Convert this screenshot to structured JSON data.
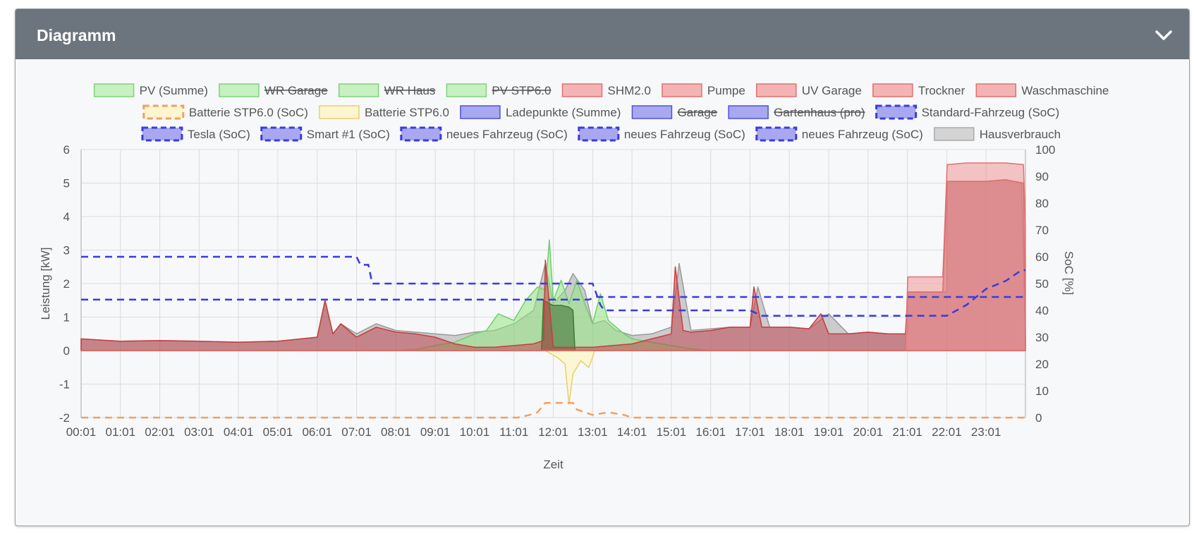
{
  "panel": {
    "title": "Diagramm"
  },
  "chart_data": {
    "type": "area",
    "xlabel": "Zeit",
    "ylabel_left": "Leistung [kW]",
    "ylabel_right": "SoC [%]",
    "ylim_left": [
      -2,
      6
    ],
    "ylim_right": [
      0,
      100
    ],
    "yticks_left": [
      "6",
      "5",
      "4",
      "3",
      "2",
      "1",
      "0",
      "-1",
      "-2"
    ],
    "yticks_right": [
      "100",
      "90",
      "80",
      "70",
      "60",
      "50",
      "40",
      "30",
      "20",
      "10",
      "0"
    ],
    "xticks": [
      "00:01",
      "01:01",
      "02:01",
      "03:01",
      "04:01",
      "05:01",
      "06:01",
      "07:01",
      "08:01",
      "09:01",
      "10:01",
      "11:01",
      "12:01",
      "13:01",
      "14:01",
      "15:01",
      "16:01",
      "17:01",
      "18:01",
      "19:01",
      "20:01",
      "21:01",
      "22:01",
      "23:01"
    ],
    "grid": true,
    "legend_position": "top",
    "legend": [
      {
        "label": "PV (Summe)",
        "color": "#7ed37e",
        "fill": "#c8f0c0",
        "style": "solid",
        "hidden": false
      },
      {
        "label": "WR Garage",
        "color": "#7ed37e",
        "fill": "#c8f0c0",
        "style": "solid",
        "hidden": true
      },
      {
        "label": "WR Haus",
        "color": "#7ed37e",
        "fill": "#c8f0c0",
        "style": "solid",
        "hidden": true
      },
      {
        "label": "PV STP6.0",
        "color": "#7ed37e",
        "fill": "#c8f0c0",
        "style": "solid",
        "hidden": true
      },
      {
        "label": "SHM2.0",
        "color": "#e07070",
        "fill": "#f4b4b4",
        "style": "solid",
        "hidden": false
      },
      {
        "label": "Pumpe",
        "color": "#e07070",
        "fill": "#f4b4b4",
        "style": "solid",
        "hidden": false
      },
      {
        "label": "UV Garage",
        "color": "#e07070",
        "fill": "#f4b4b4",
        "style": "solid",
        "hidden": false
      },
      {
        "label": "Trockner",
        "color": "#e07070",
        "fill": "#f4b4b4",
        "style": "solid",
        "hidden": false
      },
      {
        "label": "Waschmaschine",
        "color": "#e07070",
        "fill": "#f4b4b4",
        "style": "solid",
        "hidden": false
      },
      {
        "label": "Batterie STP6.0 (SoC)",
        "color": "#f0a060",
        "fill": "#fdf5d0",
        "style": "dashed",
        "hidden": false
      },
      {
        "label": "Batterie STP6.0",
        "color": "#e8cf70",
        "fill": "#fdf5d0",
        "style": "solid",
        "hidden": false
      },
      {
        "label": "Ladepunkte (Summe)",
        "color": "#5050e0",
        "fill": "#a8a8f0",
        "style": "solid",
        "hidden": false
      },
      {
        "label": "Garage",
        "color": "#5050e0",
        "fill": "#a8a8f0",
        "style": "solid",
        "hidden": true
      },
      {
        "label": "Gartenhaus (pro)",
        "color": "#5050e0",
        "fill": "#a8a8f0",
        "style": "solid",
        "hidden": true
      },
      {
        "label": "Standard-Fahrzeug (SoC)",
        "color": "#3a3ae0",
        "fill": "#a8a8f0",
        "style": "dashed",
        "hidden": false
      },
      {
        "label": "Tesla (SoC)",
        "color": "#3a3ae0",
        "fill": "#a8a8f0",
        "style": "dashed",
        "hidden": false
      },
      {
        "label": "Smart #1 (SoC)",
        "color": "#3a3ae0",
        "fill": "#a8a8f0",
        "style": "dashed",
        "hidden": false
      },
      {
        "label": "neues Fahrzeug (SoC)",
        "color": "#3a3ae0",
        "fill": "#a8a8f0",
        "style": "dashed",
        "hidden": false
      },
      {
        "label": "neues Fahrzeug (SoC)",
        "color": "#3a3ae0",
        "fill": "#a8a8f0",
        "style": "dashed",
        "hidden": false
      },
      {
        "label": "neues Fahrzeug (SoC)",
        "color": "#3a3ae0",
        "fill": "#a8a8f0",
        "style": "dashed",
        "hidden": false
      },
      {
        "label": "Hausverbrauch",
        "color": "#aaaaaa",
        "fill": "#d4d4d4",
        "style": "solid",
        "hidden": false
      }
    ],
    "series": [
      {
        "name": "Hausverbrauch",
        "axis": "left",
        "color": "#9a9a9a",
        "fill": "rgba(150,150,150,0.45)",
        "x": [
          0,
          1,
          2,
          3,
          4,
          5,
          6,
          6.2,
          6.4,
          6.6,
          7,
          7.5,
          8,
          8.5,
          9,
          9.5,
          10,
          10.5,
          11,
          11.5,
          11.8,
          12,
          12.3,
          12.5,
          12.8,
          13,
          13.3,
          13.6,
          14,
          14.5,
          15,
          15.2,
          15.5,
          16,
          16.5,
          17,
          17.2,
          17.5,
          18,
          18.5,
          19,
          19.5,
          20,
          20.5,
          21,
          21.01,
          22,
          22.01,
          23,
          23.5,
          23.9,
          24
        ],
        "y": [
          0.35,
          0.28,
          0.3,
          0.28,
          0.25,
          0.28,
          0.4,
          1.5,
          0.5,
          0.8,
          0.5,
          0.8,
          0.6,
          0.55,
          0.5,
          0.45,
          0.55,
          0.6,
          0.8,
          1.2,
          2.6,
          1.4,
          1.8,
          2.3,
          1.8,
          0.8,
          0.9,
          0.6,
          0.45,
          0.5,
          0.7,
          2.6,
          0.6,
          0.65,
          0.7,
          0.7,
          1.9,
          0.7,
          0.7,
          0.65,
          1.1,
          0.5,
          0.55,
          0.5,
          0.5,
          1.75,
          1.75,
          5.05,
          5.05,
          5.1,
          5.0,
          0.35
        ]
      },
      {
        "name": "PV (Summe)",
        "axis": "left",
        "color": "#6fcf6f",
        "fill": "rgba(150,230,130,0.55)",
        "x": [
          0,
          8,
          8.5,
          9,
          9.5,
          10,
          10.3,
          10.6,
          11,
          11.3,
          11.6,
          11.8,
          11.9,
          12,
          12.2,
          12.4,
          12.6,
          12.8,
          13,
          13.2,
          13.4,
          13.6,
          13.8,
          14,
          14.5,
          15,
          15.5,
          16,
          24
        ],
        "y": [
          0,
          0,
          0.03,
          0.15,
          0.25,
          0.5,
          0.6,
          1.1,
          0.9,
          1.5,
          1.9,
          1.8,
          3.3,
          1.5,
          2.1,
          1.4,
          2.1,
          1.4,
          0.8,
          1.7,
          0.9,
          0.7,
          0.5,
          0.35,
          0.25,
          0.15,
          0.05,
          0,
          0
        ]
      },
      {
        "name": "Pumpe",
        "axis": "left",
        "color": "#3c7a30",
        "fill": "rgba(60,110,50,0.55)",
        "x": [
          0,
          11.7,
          11.75,
          11.9,
          12,
          12.2,
          12.4,
          12.5,
          12.55,
          24
        ],
        "y": [
          0,
          0,
          1.5,
          1.4,
          1.35,
          1.35,
          1.3,
          1.2,
          0,
          0
        ]
      },
      {
        "name": "Batterie STP6.0",
        "axis": "left",
        "color": "#e8cf70",
        "fill": "rgba(253,245,200,0.8)",
        "x": [
          0,
          11.8,
          12.1,
          12.3,
          12.4,
          12.5,
          12.7,
          12.9,
          13,
          13.05,
          24
        ],
        "y": [
          0,
          0,
          -0.2,
          -0.4,
          -1.6,
          -0.7,
          -0.3,
          -0.5,
          -0.2,
          0,
          0
        ]
      },
      {
        "name": "SHM2.0",
        "axis": "left",
        "color": "#c83c3c",
        "fill": "rgba(190,60,70,0.5)",
        "x": [
          0,
          1,
          2,
          3,
          4,
          5,
          6,
          6.2,
          6.4,
          6.6,
          7,
          7.5,
          8,
          8.5,
          9,
          9.5,
          10,
          10.5,
          11,
          11.5,
          11.75,
          11.8,
          12,
          12.5,
          13,
          13.5,
          14,
          14.5,
          15,
          15.1,
          15.3,
          15.5,
          16,
          16.5,
          17,
          17.1,
          17.3,
          17.5,
          18,
          18.5,
          18.8,
          19,
          19.5,
          20,
          20.5,
          20.95,
          21.01,
          21.8,
          21.9,
          22.01,
          23,
          23.5,
          23.95,
          24
        ],
        "y": [
          0.35,
          0.28,
          0.3,
          0.28,
          0.25,
          0.28,
          0.4,
          1.5,
          0.5,
          0.8,
          0.4,
          0.7,
          0.55,
          0.5,
          0.4,
          0.2,
          0.1,
          0.1,
          0.15,
          0.2,
          0.3,
          2.7,
          0.1,
          0.1,
          0.1,
          0.15,
          0.2,
          0.35,
          0.5,
          2.5,
          0.6,
          0.55,
          0.6,
          0.7,
          0.7,
          1.9,
          0.7,
          0.7,
          0.7,
          0.65,
          1.1,
          0.5,
          0.5,
          0.55,
          0.5,
          0.5,
          1.75,
          1.75,
          1.75,
          5.05,
          5.05,
          5.1,
          5.0,
          0.35
        ]
      },
      {
        "name": "Waschmaschine",
        "axis": "left",
        "color": "#e07070",
        "fill": "rgba(240,150,150,0.55)",
        "x": [
          0,
          20.95,
          21.01,
          21.8,
          21.9,
          22.01,
          22.5,
          23,
          23.5,
          23.95,
          24
        ],
        "y": [
          0,
          0,
          2.2,
          2.2,
          2.2,
          5.55,
          5.6,
          5.6,
          5.6,
          5.55,
          3.7
        ]
      },
      {
        "name": "Tesla (SoC)",
        "axis": "right",
        "color": "#3a3ae0",
        "dash": "10,7",
        "x": [
          0,
          7,
          7.1,
          7.3,
          7.4,
          13,
          13.2,
          13.3,
          14.5,
          17,
          17.3,
          21.5,
          22,
          22.5,
          23,
          23.5,
          23.9,
          24
        ],
        "y": [
          60,
          60,
          57,
          57,
          50,
          50,
          42,
          40,
          40,
          40,
          38,
          38,
          38,
          42,
          48,
          51,
          55,
          55
        ]
      },
      {
        "name": "Standard-Fahrzeug (SoC)",
        "axis": "right",
        "color": "#3a3ae0",
        "dash": "10,7",
        "x": [
          0,
          12.9,
          13.1,
          24
        ],
        "y": [
          44,
          44,
          45,
          45
        ]
      },
      {
        "name": "Batterie STP6.0 (SoC)",
        "axis": "right",
        "color": "#f0a060",
        "dash": "10,7",
        "x": [
          0,
          11.1,
          11.4,
          11.6,
          11.8,
          12.5,
          12.6,
          13,
          13.4,
          13.8,
          14,
          14.3,
          24
        ],
        "y": [
          0,
          0,
          1,
          2,
          5.5,
          5.5,
          3,
          1,
          2,
          1,
          0,
          0,
          0
        ]
      }
    ]
  }
}
